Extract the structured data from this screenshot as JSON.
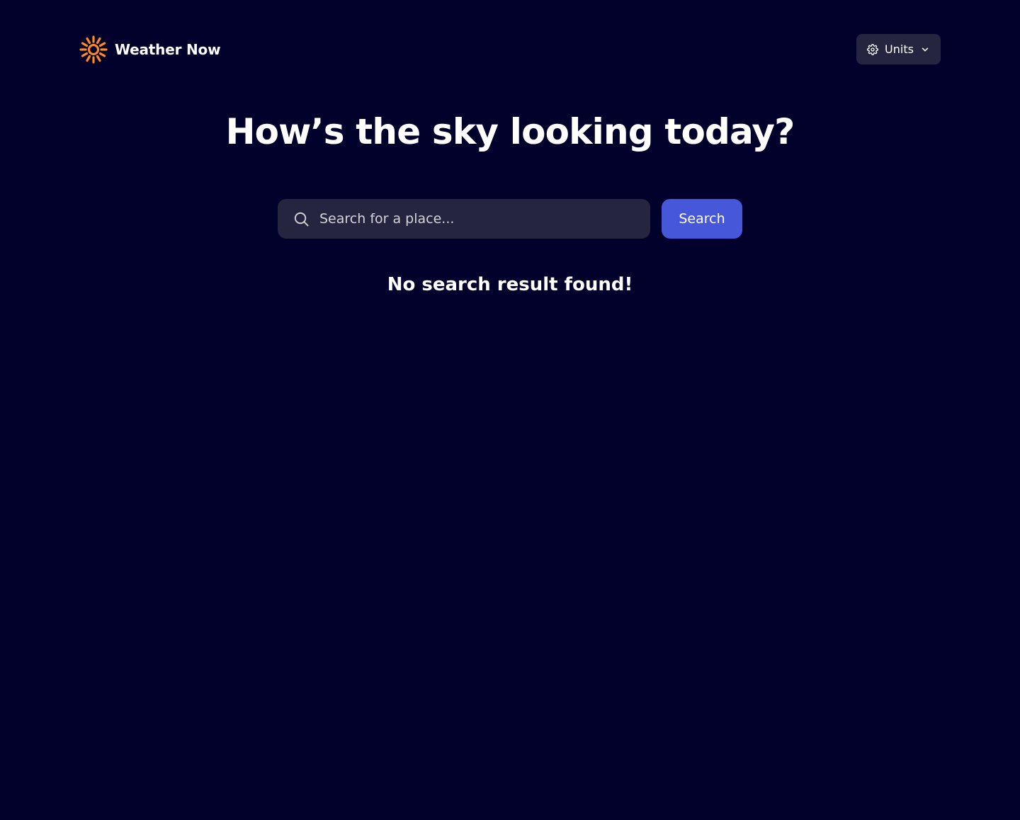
{
  "header": {
    "brand_name": "Weather Now",
    "logo_icon": "sun-icon",
    "logo_color": "#ff8a1f",
    "units_button": {
      "label": "Units",
      "icon": "gear-icon",
      "chevron_icon": "chevron-down-icon"
    }
  },
  "hero": {
    "title": "How’s the sky looking today?"
  },
  "search": {
    "icon": "search-icon",
    "placeholder": "Search for a place...",
    "value": "",
    "button_label": "Search"
  },
  "results": {
    "empty_message": "No search result found!"
  },
  "colors": {
    "background": "#02012b",
    "surface": "#25253f",
    "accent": "#4658d9",
    "text": "#ffffff",
    "muted_text": "#d4d3d9"
  }
}
